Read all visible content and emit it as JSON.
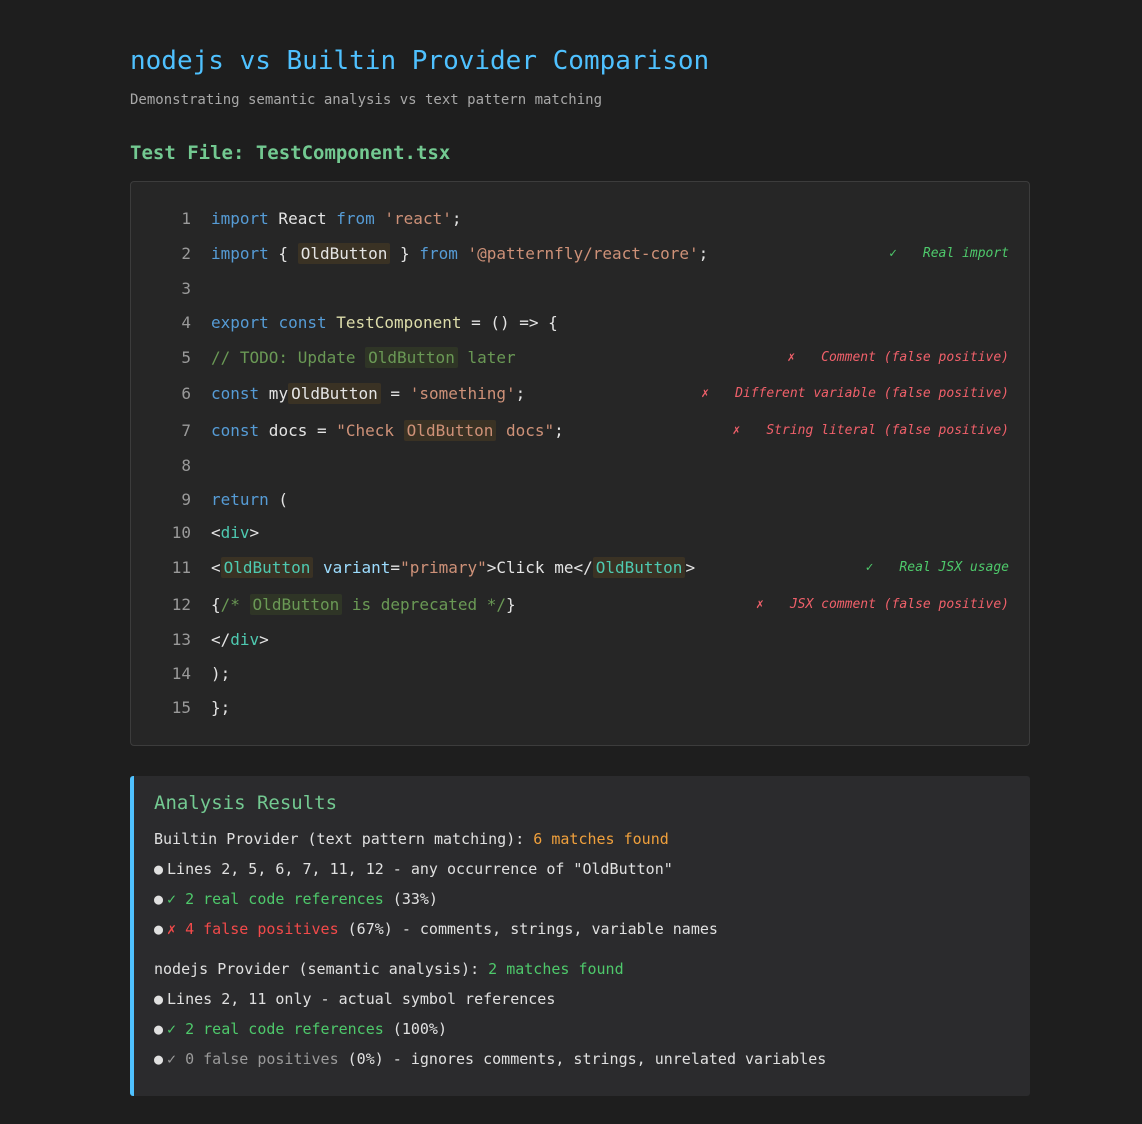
{
  "title": "nodejs vs Builtin Provider Comparison",
  "subtitle": "Demonstrating semantic analysis vs text pattern matching",
  "file_heading": "Test File: TestComponent.tsx",
  "colors": {
    "accent": "#4fc1ff",
    "heading_green": "#73c991",
    "ok": "#4ec96b",
    "bad": "#f0606a",
    "orange": "#f0a03c"
  },
  "code": {
    "line_numbers": [
      "1",
      "2",
      "3",
      "4",
      "5",
      "6",
      "7",
      "8",
      "9",
      "10",
      "11",
      "12",
      "13",
      "14",
      "15"
    ],
    "l1": {
      "a": "import",
      "b": " React ",
      "c": "from",
      "d": " ",
      "e": "'react'",
      "f": ";"
    },
    "l2": {
      "a": "import",
      "b": " { ",
      "c": "OldButton",
      "d": " } ",
      "e": "from",
      "f": " ",
      "g": "'@patternfly/react-core'",
      "h": ";"
    },
    "l4": {
      "a": "export",
      "b": " ",
      "c": "const",
      "d": " ",
      "e": "TestComponent",
      "f": " = () => {"
    },
    "l5": {
      "a": "// TODO: Update ",
      "b": "OldButton",
      "c": " later"
    },
    "l6": {
      "a": "const",
      "b": " my",
      "c": "OldButton",
      "d": " = ",
      "e": "'something'",
      "f": ";"
    },
    "l7": {
      "a": "const",
      "b": " docs = ",
      "c": "\"Check ",
      "d": "OldButton",
      "e": " docs\"",
      "f": ";"
    },
    "l9": {
      "a": "return",
      "b": " ("
    },
    "l10": {
      "a": "<",
      "b": "div",
      "c": ">"
    },
    "l11": {
      "a": "<",
      "b": "OldButton",
      "c": " ",
      "d": "variant",
      "e": "=",
      "f": "\"primary\"",
      "g": ">Click me</",
      "h": "OldButton",
      "i": ">"
    },
    "l12": {
      "a": "{",
      "b": "/* ",
      "c": "OldButton",
      "d": " is deprecated */",
      "e": "}"
    },
    "l13": {
      "a": "</",
      "b": "div",
      "c": ">"
    },
    "l14": {
      "a": ");"
    },
    "l15": {
      "a": "};"
    }
  },
  "annotations": {
    "l2": {
      "mark": "✓",
      "text": "Real import"
    },
    "l5": {
      "mark": "✗",
      "text": "Comment (false positive)"
    },
    "l6": {
      "mark": "✗",
      "text": "Different variable (false positive)"
    },
    "l7": {
      "mark": "✗",
      "text": "String literal (false positive)"
    },
    "l11": {
      "mark": "✓",
      "text": "Real JSX usage"
    },
    "l12": {
      "mark": "✗",
      "text": "JSX comment (false positive)"
    }
  },
  "results": {
    "title": "Analysis Results",
    "builtin": {
      "heading": "Builtin Provider (text pattern matching): ",
      "count": "6 matches found",
      "b1": "Lines 2, 5, 6, 7, 11, 12 - any occurrence of \"OldButton\"",
      "b2_mark": "✓ 2 real code references",
      "b2_rest": " (33%)",
      "b3_mark": "✗ 4 false positives",
      "b3_rest": " (67%) - comments, strings, variable names"
    },
    "nodejs": {
      "heading": "nodejs Provider (semantic analysis): ",
      "count": "2 matches found",
      "b1": "Lines 2, 11 only - actual symbol references",
      "b2_mark": "✓ 2 real code references",
      "b2_rest": " (100%)",
      "b3_mark": "✓ 0 false positives",
      "b3_rest": " (0%) - ignores comments, strings, unrelated variables"
    },
    "bullet": "●"
  }
}
